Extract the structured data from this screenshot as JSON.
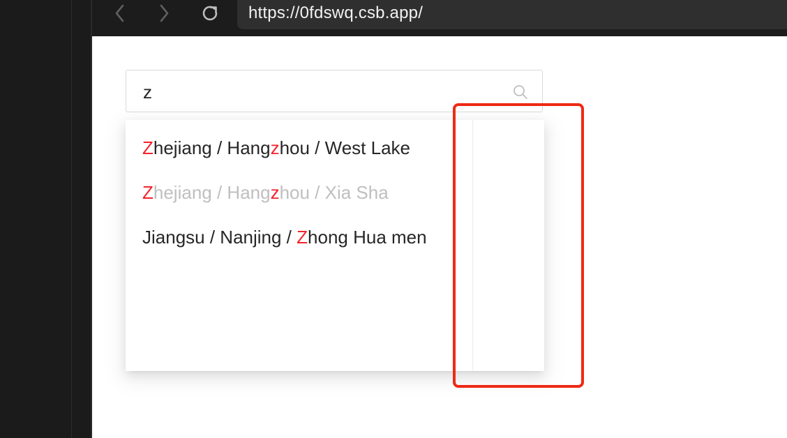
{
  "browser": {
    "url": "https://0fdswq.csb.app/",
    "back_icon": "chevron-left-icon",
    "forward_icon": "chevron-right-icon",
    "reload_icon": "reload-icon"
  },
  "search": {
    "value": "z",
    "icon": "search-icon"
  },
  "options": [
    {
      "parts": [
        "",
        "Z",
        "hejiang / Hang",
        "z",
        "hou / West Lake"
      ],
      "disabled": false
    },
    {
      "parts": [
        "",
        "Z",
        "hejiang / Hang",
        "z",
        "hou / Xia Sha"
      ],
      "disabled": true
    },
    {
      "parts": [
        "Jiangsu / Nanjing / ",
        "Z",
        "hong Hua men"
      ],
      "disabled": false
    }
  ],
  "colors": {
    "highlight": "#f5222d",
    "annotation": "#ee2a14",
    "disabled_text": "#bfbfbf"
  }
}
